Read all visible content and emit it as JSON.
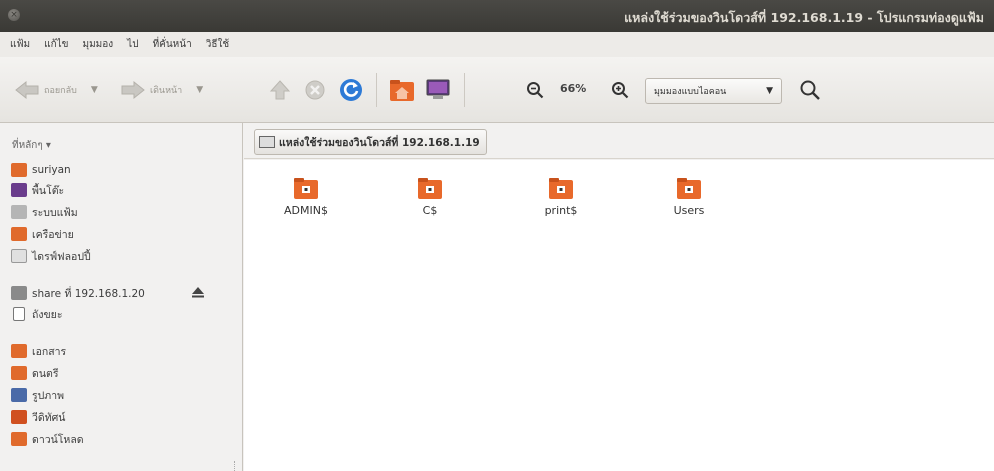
{
  "window": {
    "title": "แหล่งใช้ร่วมของวินโดวส์ที่ 192.168.1.19 - โปรแกรมท่องดูแฟ้ม"
  },
  "menubar": {
    "items": [
      "แฟ้ม",
      "แก้ไข",
      "มุมมอง",
      "ไป",
      "ที่คั่นหน้า",
      "วิธีใช้"
    ]
  },
  "toolbar": {
    "back_label": "ถอยกลับ",
    "forward_label": "เดินหน้า",
    "zoom_level": "66%",
    "view_mode": "มุมมองแบบไอคอน",
    "icons": [
      "back-arrow-icon",
      "forward-arrow-icon",
      "up-arrow-icon",
      "stop-icon",
      "reload-icon",
      "home-folder-icon",
      "computer-icon",
      "zoom-out-icon",
      "zoom-in-icon",
      "search-icon"
    ]
  },
  "sidebar": {
    "header": "ที่หลักๆ",
    "items": [
      {
        "label": "suriyan",
        "icon": "home-folder-icon",
        "color": "#e06a2c"
      },
      {
        "label": "พื้นโต๊ะ",
        "icon": "desktop-icon",
        "color": "#6a3c8c"
      },
      {
        "label": "ระบบแฟ้ม",
        "icon": "filesystem-icon",
        "color": "#9a9a9a"
      },
      {
        "label": "เครือข่าย",
        "icon": "network-icon",
        "color": "#e06a2c"
      },
      {
        "label": "ไดรฟ์ฟลอปปี้",
        "icon": "floppy-icon",
        "color": "#cfcfcf"
      },
      {
        "label": "share ที่ 192.168.1.20",
        "icon": "network-share-icon",
        "color": "#8a8a8a"
      },
      {
        "label": "ถังขยะ",
        "icon": "trash-icon",
        "color": "#9a9a9a"
      },
      {
        "label": "เอกสาร",
        "icon": "documents-folder-icon",
        "color": "#e06a2c"
      },
      {
        "label": "ดนตรี",
        "icon": "music-folder-icon",
        "color": "#e06a2c"
      },
      {
        "label": "รูปภาพ",
        "icon": "pictures-folder-icon",
        "color": "#4a6aa8"
      },
      {
        "label": "วีดิทัศน์",
        "icon": "videos-folder-icon",
        "color": "#d05020"
      },
      {
        "label": "ดาวน์โหลด",
        "icon": "downloads-folder-icon",
        "color": "#e06a2c"
      }
    ]
  },
  "pathbar": {
    "crumb": "แหล่งใช้ร่วมของวินโดวส์ที่ 192.168.1.19"
  },
  "content": {
    "folders": [
      {
        "name": "ADMIN$"
      },
      {
        "name": "C$"
      },
      {
        "name": "print$"
      },
      {
        "name": "Users"
      }
    ]
  },
  "colors": {
    "titlebar": "#3c3b37",
    "folder_orange": "#e8692b",
    "accent": "#dd4814"
  }
}
